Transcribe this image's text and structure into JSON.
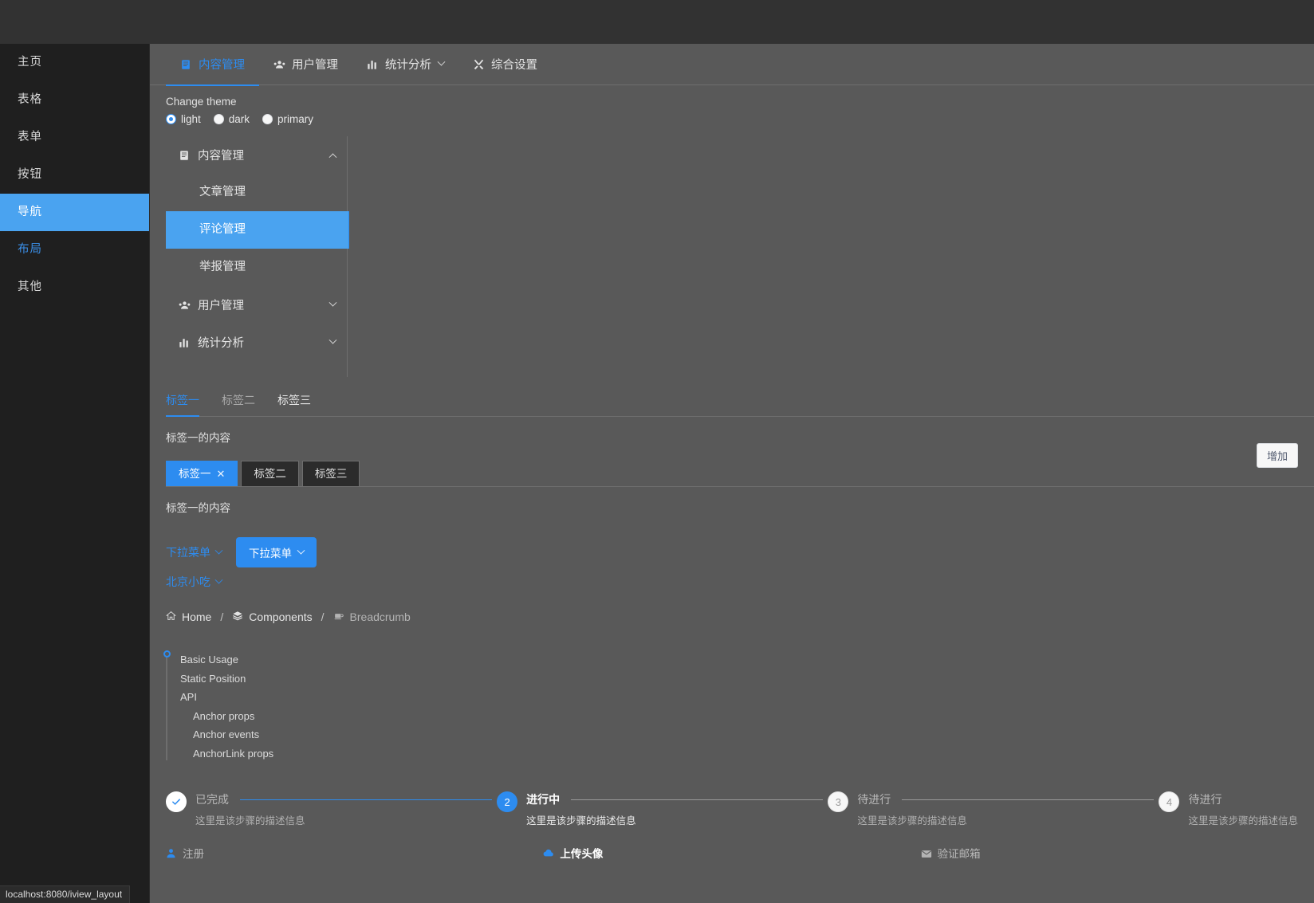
{
  "sidebar": {
    "items": [
      {
        "label": "主页",
        "state": "normal"
      },
      {
        "label": "表格",
        "state": "normal"
      },
      {
        "label": "表单",
        "state": "normal"
      },
      {
        "label": "按钮",
        "state": "normal"
      },
      {
        "label": "导航",
        "state": "active"
      },
      {
        "label": "布局",
        "state": "link"
      },
      {
        "label": "其他",
        "state": "normal"
      }
    ]
  },
  "topmenu": {
    "items": [
      {
        "label": "内容管理",
        "icon": "document-icon",
        "active": true,
        "chevron": false
      },
      {
        "label": "用户管理",
        "icon": "users-icon",
        "active": false,
        "chevron": false
      },
      {
        "label": "统计分析",
        "icon": "bar-chart-icon",
        "active": false,
        "chevron": true
      },
      {
        "label": "综合设置",
        "icon": "tools-icon",
        "active": false,
        "chevron": false
      }
    ]
  },
  "theme": {
    "label": "Change theme",
    "options": [
      {
        "label": "light",
        "selected": true
      },
      {
        "label": "dark",
        "selected": false
      },
      {
        "label": "primary",
        "selected": false
      }
    ]
  },
  "vmenu": {
    "groups": [
      {
        "label": "内容管理",
        "icon": "document-icon",
        "expanded": true,
        "children": [
          {
            "label": "文章管理",
            "active": false
          },
          {
            "label": "评论管理",
            "active": true
          },
          {
            "label": "举报管理",
            "active": false
          }
        ]
      },
      {
        "label": "用户管理",
        "icon": "users-icon",
        "expanded": false,
        "children": []
      },
      {
        "label": "统计分析",
        "icon": "bar-chart-icon",
        "expanded": false,
        "children": []
      }
    ]
  },
  "tabs": {
    "items": [
      {
        "label": "标签一",
        "active": true
      },
      {
        "label": "标签二",
        "active": false
      },
      {
        "label": "标签三",
        "active": false
      }
    ],
    "content": "标签一的内容"
  },
  "card_tabs": {
    "items": [
      {
        "label": "标签一",
        "active": true,
        "closable": true
      },
      {
        "label": "标签二",
        "active": false,
        "closable": false
      },
      {
        "label": "标签三",
        "active": false,
        "closable": false
      }
    ],
    "add_button": "增加",
    "content": "标签一的内容"
  },
  "dropdowns": {
    "link1": "下拉菜单",
    "button1": "下拉菜单",
    "link2": "北京小吃"
  },
  "breadcrumb": {
    "items": [
      {
        "label": "Home",
        "icon": "home-icon",
        "last": false
      },
      {
        "label": "Components",
        "icon": "layers-icon",
        "last": false
      },
      {
        "label": "Breadcrumb",
        "icon": "coffee-icon",
        "last": true
      }
    ],
    "separator": "/"
  },
  "anchor": {
    "links": [
      {
        "label": "Basic Usage",
        "sub": false,
        "active": true
      },
      {
        "label": "Static Position",
        "sub": false,
        "active": false
      },
      {
        "label": "API",
        "sub": false,
        "active": false
      },
      {
        "label": "Anchor props",
        "sub": true,
        "active": false
      },
      {
        "label": "Anchor events",
        "sub": true,
        "active": false
      },
      {
        "label": "AnchorLink props",
        "sub": true,
        "active": false
      }
    ]
  },
  "steps": {
    "items": [
      {
        "title": "已完成",
        "desc": "这里是该步骤的描述信息",
        "status": "finish",
        "marker": "check"
      },
      {
        "title": "进行中",
        "desc": "这里是该步骤的描述信息",
        "status": "process",
        "marker": "2"
      },
      {
        "title": "待进行",
        "desc": "这里是该步骤的描述信息",
        "status": "wait",
        "marker": "3"
      },
      {
        "title": "待进行",
        "desc": "这里是该步骤的描述信息",
        "status": "wait",
        "marker": "4"
      }
    ]
  },
  "steps_icon": {
    "items": [
      {
        "title": "注册",
        "icon": "person-icon",
        "status": "finish"
      },
      {
        "title": "上传头像",
        "icon": "cloud-upload-icon",
        "status": "process"
      },
      {
        "title": "验证邮箱",
        "icon": "mail-icon",
        "status": "wait"
      }
    ]
  },
  "statusbar": {
    "url": "localhost:8080/iview_layout"
  },
  "colors": {
    "accent": "#2d8cf0",
    "accent_light": "#4aa3f0",
    "sidebar_bg": "#1f1f1f",
    "content_bg": "#595959",
    "chrome_bg": "#323232"
  }
}
